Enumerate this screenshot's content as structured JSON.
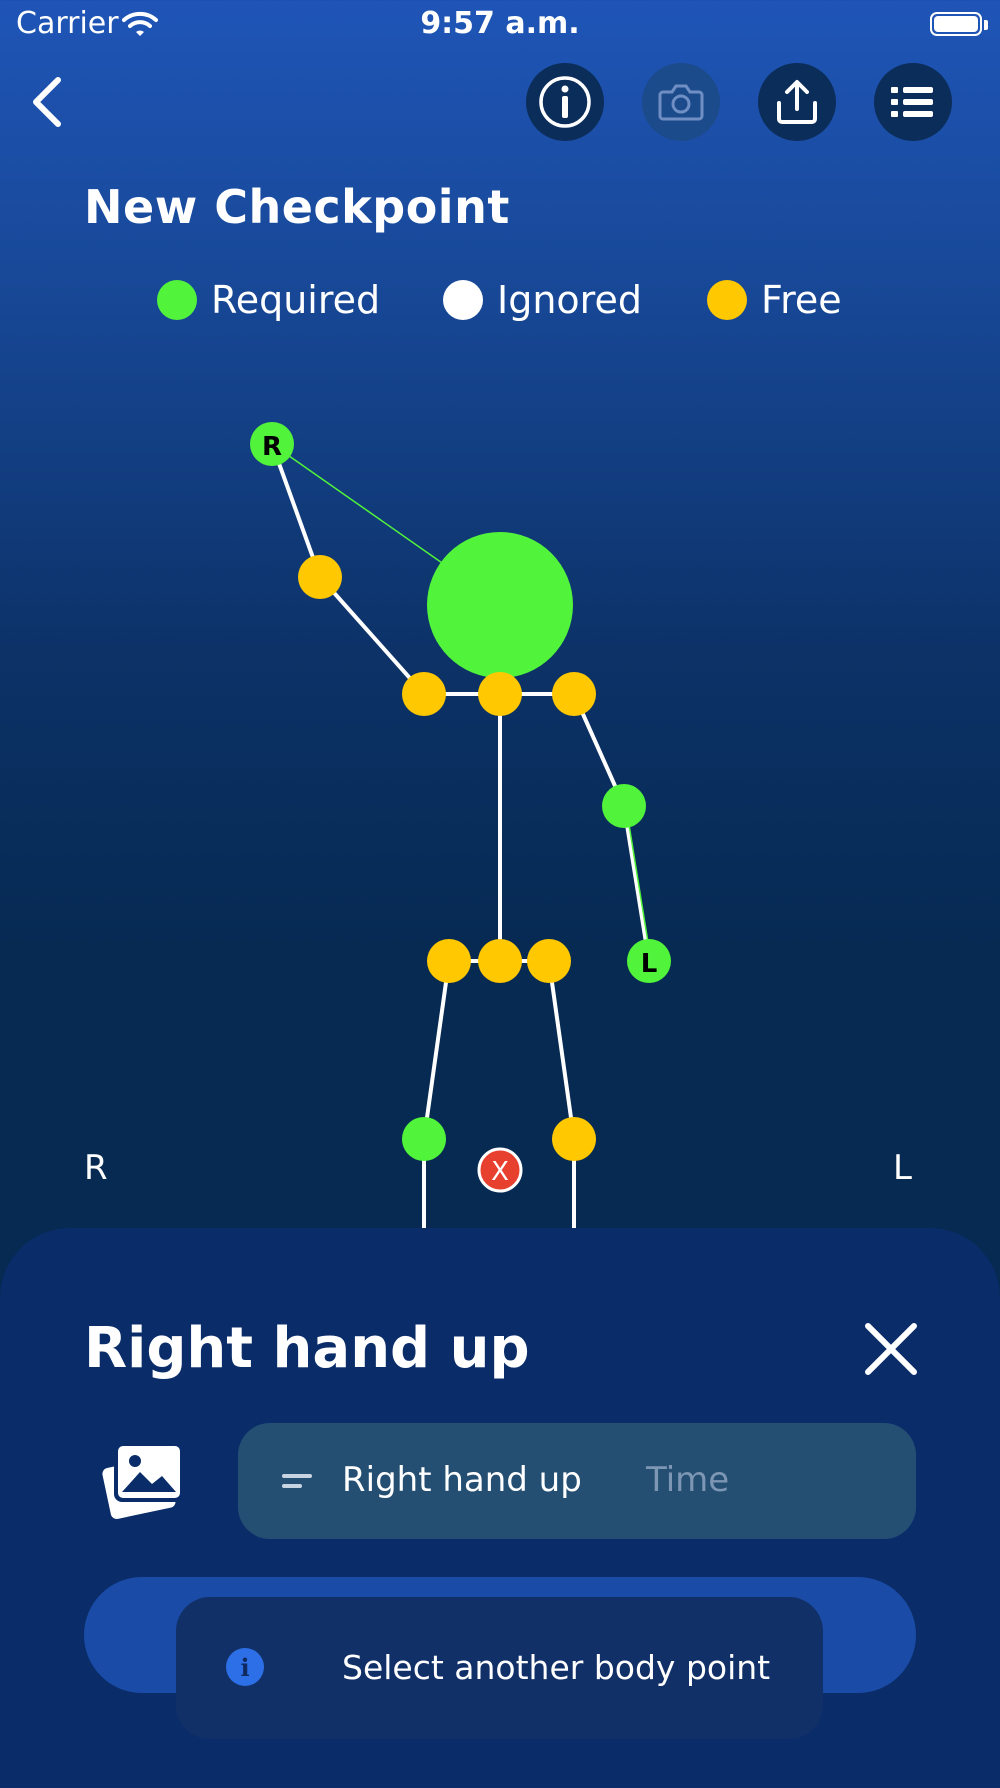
{
  "status_bar": {
    "carrier": "Carrier",
    "time": "9:57 a.m."
  },
  "toolbar": {
    "back_icon": "chevron-left-icon",
    "buttons": [
      {
        "icon": "info-icon",
        "enabled": true
      },
      {
        "icon": "camera-icon",
        "enabled": false
      },
      {
        "icon": "share-icon",
        "enabled": true
      },
      {
        "icon": "list-icon",
        "enabled": true
      }
    ]
  },
  "page_title": "New Checkpoint",
  "legend": [
    {
      "label": "Required",
      "color": "#52f33b"
    },
    {
      "label": "Ignored",
      "color": "#ffffff"
    },
    {
      "label": "Free",
      "color": "#ffc800"
    }
  ],
  "skeleton": {
    "right_hand_marker": "R",
    "left_hand_marker": "L",
    "remove_marker": "X",
    "colors": {
      "required": "#52f33b",
      "free": "#ffc800",
      "remove": "#e8402f"
    }
  },
  "side_labels": {
    "right": "R",
    "left": "L"
  },
  "sheet": {
    "title": "Right hand up",
    "name_value": "Right hand up",
    "time_placeholder": "Time",
    "toast_text": "Select another body point"
  }
}
